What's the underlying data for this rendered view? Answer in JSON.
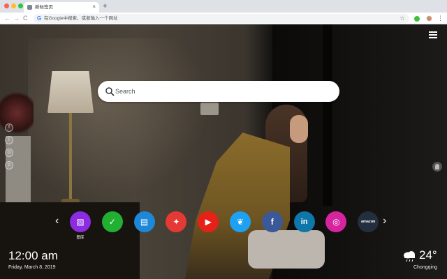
{
  "browser": {
    "tab_title": "新标签页",
    "tab_close": "×",
    "new_tab": "+",
    "omnibox_text": "在Google中搜索，或者输入一个网址",
    "nav_back": "←",
    "nav_forward": "→",
    "nav_reload": "C",
    "star": "☆",
    "kebab": "⋮"
  },
  "search": {
    "placeholder": "Search",
    "icon": "search-icon"
  },
  "social": [
    "facebook-icon",
    "twitter-icon",
    "instagram-icon",
    "pinterest-icon"
  ],
  "dock": {
    "prev": "‹",
    "next": "›",
    "shortcuts": [
      {
        "name": "gallery",
        "label": "图库",
        "color": "#8b2be2",
        "icon": "image-icon"
      },
      {
        "name": "tasks",
        "label": "",
        "color": "#22b033",
        "icon": "check-icon"
      },
      {
        "name": "notes",
        "label": "",
        "color": "#1e88d8",
        "icon": "note-icon"
      },
      {
        "name": "games",
        "label": "",
        "color": "#e53935",
        "icon": "gamepad-icon"
      },
      {
        "name": "youtube",
        "label": "",
        "color": "#e62117",
        "icon": "play-icon"
      },
      {
        "name": "twitter",
        "label": "",
        "color": "#1da1f2",
        "icon": "bird-icon"
      },
      {
        "name": "facebook",
        "label": "",
        "color": "#3b5998",
        "icon": "f-icon"
      },
      {
        "name": "linkedin",
        "label": "",
        "color": "#0e76a8",
        "icon": "in-icon"
      },
      {
        "name": "instagram",
        "label": "",
        "color": "#d6249f",
        "icon": "camera-icon"
      },
      {
        "name": "amazon",
        "label": "",
        "color": "#232f3e",
        "icon": "amazon-icon",
        "text": "amazon"
      }
    ]
  },
  "clock": {
    "time": "12:00 am",
    "date": "Friday, March 8, 2019"
  },
  "weather": {
    "temp": "24°",
    "city": "Chongqing",
    "icon": "cloud-rain-icon"
  }
}
